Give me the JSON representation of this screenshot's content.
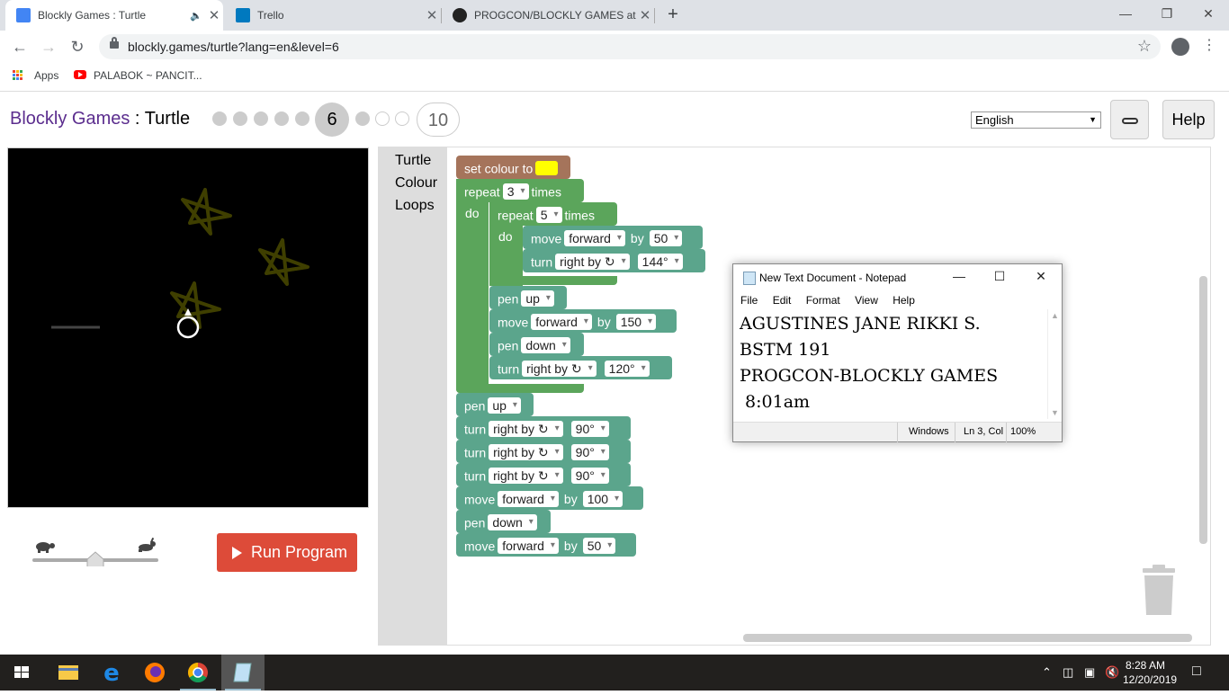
{
  "browser": {
    "tabs": [
      {
        "title": "Blockly Games : Turtle",
        "active": true
      },
      {
        "title": "Trello",
        "active": false
      },
      {
        "title": "PROGCON/BLOCKLY GAMES at m",
        "active": false
      }
    ],
    "url": "blockly.games/turtle?lang=en&level=6",
    "bookmarks": [
      {
        "label": "Apps"
      },
      {
        "label": "PALABOK ~ PANCIT..."
      }
    ]
  },
  "page": {
    "brand": "Blockly Games",
    "separator": " : ",
    "game": "Turtle",
    "current_level": "6",
    "max_level": "10",
    "completed_levels": 5,
    "language": "English",
    "help_label": "Help",
    "run_label": "Run Program"
  },
  "toolbox": {
    "categories": [
      "Turtle",
      "Colour",
      "Loops"
    ]
  },
  "blocks": {
    "set_colour": {
      "label": "set colour to",
      "color": "#ffff00"
    },
    "outer_repeat": {
      "label": "repeat",
      "count": "3",
      "suffix": "times",
      "do": "do"
    },
    "inner_repeat": {
      "label": "repeat",
      "count": "5",
      "suffix": "times",
      "do": "do"
    },
    "move1": {
      "label": "move",
      "dir": "forward",
      "by": "by",
      "value": "50"
    },
    "turn1": {
      "label": "turn",
      "dir": "right by ↻",
      "value": "144°"
    },
    "pen1": {
      "label": "pen",
      "state": "up"
    },
    "move2": {
      "label": "move",
      "dir": "forward",
      "by": "by",
      "value": "150"
    },
    "pen2": {
      "label": "pen",
      "state": "down"
    },
    "turn2": {
      "label": "turn",
      "dir": "right by ↻",
      "value": "120°"
    },
    "pen3": {
      "label": "pen",
      "state": "up"
    },
    "turn3": {
      "label": "turn",
      "dir": "right by ↻",
      "value": "90°"
    },
    "turn4": {
      "label": "turn",
      "dir": "right by ↻",
      "value": "90°"
    },
    "turn5": {
      "label": "turn",
      "dir": "right by ↻",
      "value": "90°"
    },
    "move3": {
      "label": "move",
      "dir": "forward",
      "by": "by",
      "value": "100"
    },
    "pen4": {
      "label": "pen",
      "state": "down"
    },
    "move4": {
      "label": "move",
      "dir": "forward",
      "by": "by",
      "value": "50"
    }
  },
  "notepad": {
    "title": "New Text Document - Notepad",
    "menu": [
      "File",
      "Edit",
      "Format",
      "View",
      "Help"
    ],
    "lines": [
      "AGUSTINES JANE RIKKI S.",
      "BSTM 191",
      "PROGCON-BLOCKLY GAMES",
      " 8:01am"
    ],
    "status": {
      "eol": "Windows",
      "position": "Ln 3, Col",
      "zoom": "100%"
    }
  },
  "taskbar": {
    "time": "8:28 AM",
    "date": "12/20/2019"
  },
  "colors": {
    "brand": "#5b2d8e",
    "run_button": "#dd4b39",
    "loop_block": "#5ba55b",
    "turtle_block": "#5ba58c",
    "colour_block": "#a5745b",
    "star_stroke": "#3f3f00"
  }
}
